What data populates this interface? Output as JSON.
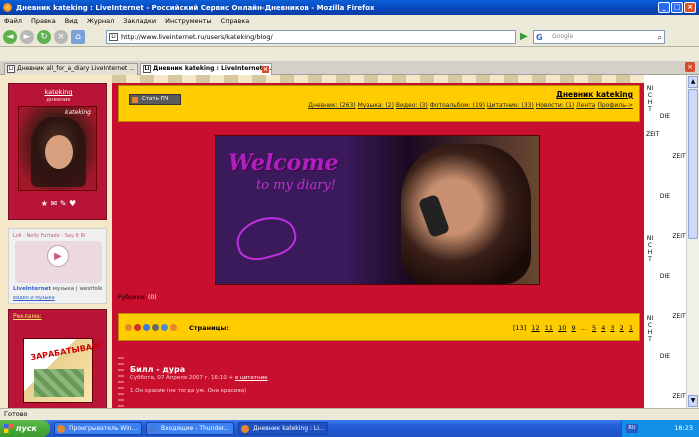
{
  "window": {
    "title": "Дневник kateking : LiveInternet - Российский Сервис Онлайн-Дневников - Mozilla Firefox"
  },
  "menu": [
    "Файл",
    "Правка",
    "Вид",
    "Журнал",
    "Закладки",
    "Инструменты",
    "Справка"
  ],
  "nav": {
    "url": "http://www.liveinternet.ru/users/kateking/blog/",
    "search_placeholder": "Google"
  },
  "tabs": [
    {
      "label": "Дневник all_for_a_diary LiveInternet ..."
    },
    {
      "label": "Дневник kateking : LiveInternet ..."
    }
  ],
  "sidebar": {
    "username": "kateking",
    "usertype": "дневник",
    "avatar_caption": "kateking",
    "player_track": "Loll - Nelly Furtado - Say It Ri",
    "player_brand": "LiveInternet",
    "player_brand2": "музыка",
    "player_brand3": "westfolk",
    "player_link": "видео и музыка",
    "ad_label": "Реклама:",
    "ad_text": "ЗАРАБАТЫВАЙ!"
  },
  "header": {
    "post_button": "Стать ПЧ",
    "diary_title": "Дневник kateking",
    "nav_links": [
      "Дневник: (263)",
      "Музыка: (2)",
      "Видео: (3)",
      "Фотоальбом: (19)",
      "Цитатник: (33)",
      "Новости: (1)",
      "Лента",
      "Профиль->"
    ]
  },
  "banner": {
    "line1": "Welcome",
    "line2": "to my diary!"
  },
  "rubrics": {
    "label": "Рубрики:",
    "value": "(0)"
  },
  "pages": {
    "label": "Страницы:",
    "current": "[13]",
    "numbers": [
      "12",
      "11",
      "10",
      "9",
      "...",
      "5",
      "4",
      "3",
      "2",
      "1"
    ]
  },
  "post": {
    "title": "Билл - дура",
    "meta": "Суббота, 07 Апреля 2007 г. 16:10 +",
    "meta_link": "в цитатник",
    "text": "1.Он красив (не тогда уж. Она красива)"
  },
  "right_strip": {
    "text1": "DIE",
    "text2": "ZEIT",
    "text3": "NICHT"
  },
  "status": "Готово",
  "taskbar": {
    "start": "пуск",
    "tasks": [
      "Проигрыватель Win...",
      "Входящие - Thunder...",
      "Дневник kateking : Li..."
    ],
    "lang": "RU",
    "time": "18:23"
  }
}
